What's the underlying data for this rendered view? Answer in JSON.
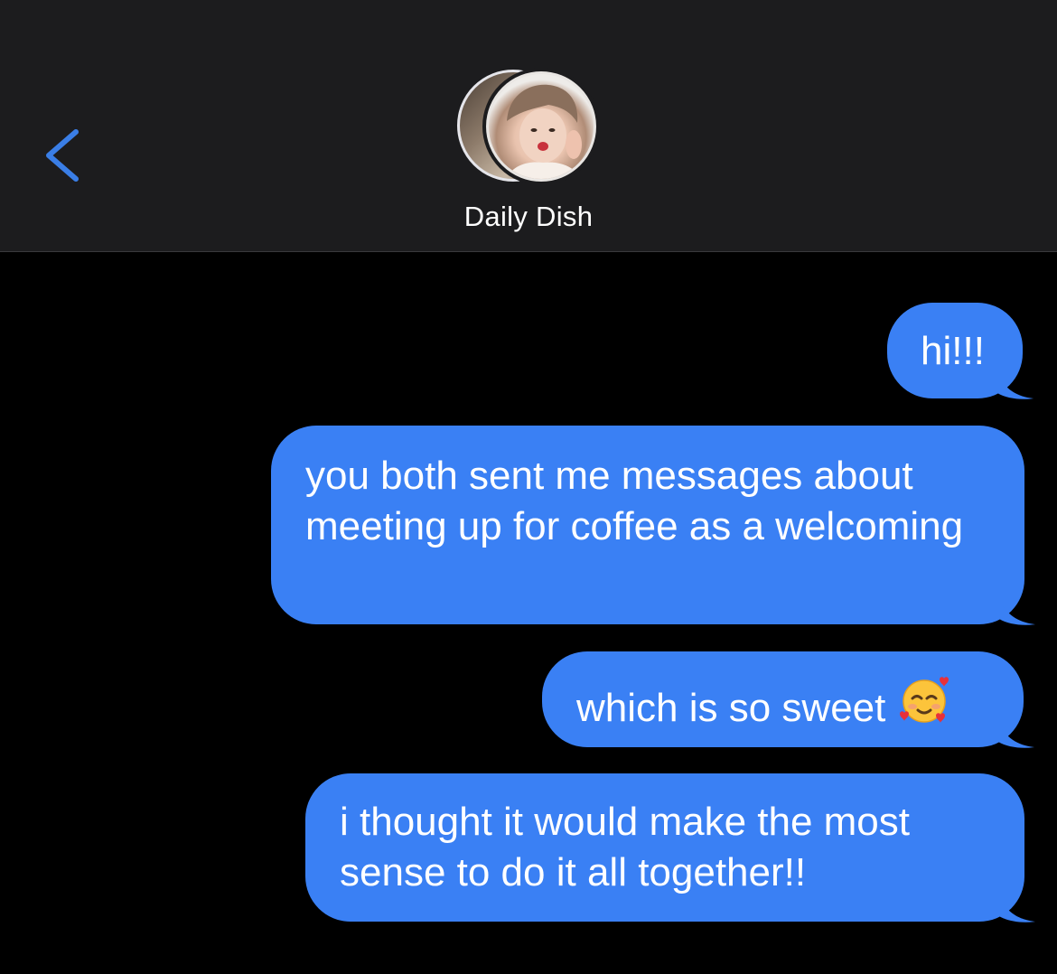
{
  "header": {
    "contact_name": "Daily Dish",
    "back_icon": "chevron-left-icon",
    "background_color": "#1c1c1e",
    "accent_color": "#3a7ee6"
  },
  "messages": [
    {
      "text": "hi!!!"
    },
    {
      "text": "you both sent me messages about meeting up for coffee as a welcoming"
    },
    {
      "text": "which is so sweet",
      "emoji": "smiling-face-with-hearts"
    },
    {
      "text": "i thought it would make the most sense to do it all together!!"
    }
  ],
  "bubble_color": "#3a80f4"
}
